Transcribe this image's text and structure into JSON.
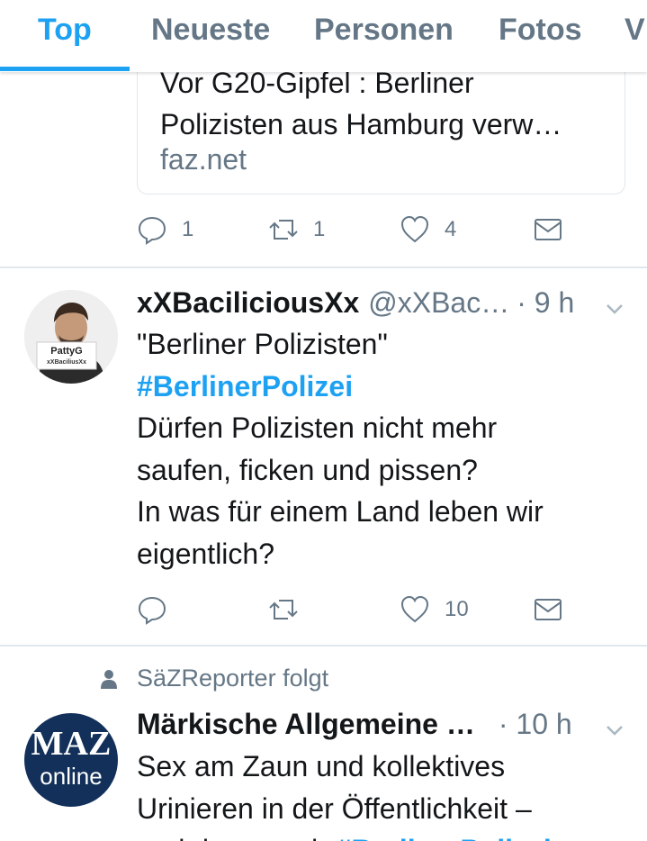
{
  "tabs": [
    {
      "label": "Top"
    },
    {
      "label": "Neueste"
    },
    {
      "label": "Personen"
    },
    {
      "label": "Fotos"
    },
    {
      "label": "V"
    }
  ],
  "link_card": {
    "title_line1": "Vor G20-Gipfel : Berliner",
    "title_line2": "Polizisten aus Hamburg verw…",
    "domain": "faz.net"
  },
  "tweet1_actions": {
    "reply_count": "1",
    "retweet_count": "1",
    "like_count": "4"
  },
  "tweet2": {
    "avatar_sign": "PattyG",
    "avatar_sign_sub": "xXBaciliusXx",
    "name": "xXBaciliciousXx",
    "handle": "@xXBac…",
    "time": "· 9 h",
    "line1": "\"Berliner Polizisten\"",
    "hashtag": "#BerlinerPolizei",
    "line3": "Dürfen Polizisten nicht mehr",
    "line4": "saufen, ficken und pissen?",
    "line5": "In was für einem Land leben wir",
    "line6": "eigentlich?",
    "like_count": "10"
  },
  "tweet3": {
    "social_context": "SäZReporter folgt",
    "avatar_line1": "MAZ",
    "avatar_line2": "online",
    "name": "Märkische Allgemeine …",
    "time": "· 10 h",
    "line1": "Sex am Zaun und kollektives",
    "line2": "Urinieren in der Öffentlichkeit –",
    "line3_partial": "und dann auch",
    "line3_hashtag": "#BerlinerPolizei"
  },
  "colors": {
    "accent": "#1da1f2",
    "muted": "#657786",
    "text": "#14171a",
    "border": "#e1e8ed"
  }
}
